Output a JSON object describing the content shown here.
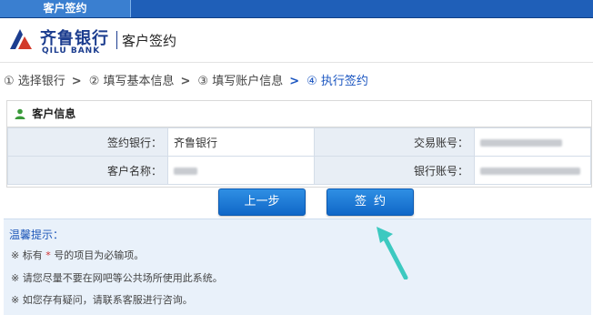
{
  "header": {
    "tab_label": "客户签约"
  },
  "brand": {
    "name_cn": "齐鲁银行",
    "name_en": "QILU BANK",
    "page_title": "客户签约"
  },
  "steps": [
    {
      "label": "① 选择银行"
    },
    {
      "label": "② 填写基本信息"
    },
    {
      "label": "③ 填写账户信息"
    },
    {
      "label": "④ 执行签约"
    }
  ],
  "customer_info": {
    "title": "客户信息",
    "rows": [
      {
        "left_label": "签约银行：",
        "left_value": "齐鲁银行",
        "right_label": "交易账号："
      },
      {
        "left_label": "客户名称：",
        "right_label": "银行账号："
      }
    ]
  },
  "actions": {
    "prev_label": "上一步",
    "sign_label": "签约"
  },
  "tips": {
    "title": "温馨提示：",
    "line1_a": "※ 标有 ",
    "line1_star": "*",
    "line1_b": " 号的项目为必输项。",
    "line2": "※ 请您尽量不要在网吧等公共场所使用此系统。",
    "line3": "※ 如您存有疑问，请联系客服进行咨询。"
  },
  "colors": {
    "primary": "#1f5fb8",
    "button": "#1a73d4",
    "tip_bg": "#e9f1fa",
    "accent_arrow": "#3cc9c0"
  }
}
